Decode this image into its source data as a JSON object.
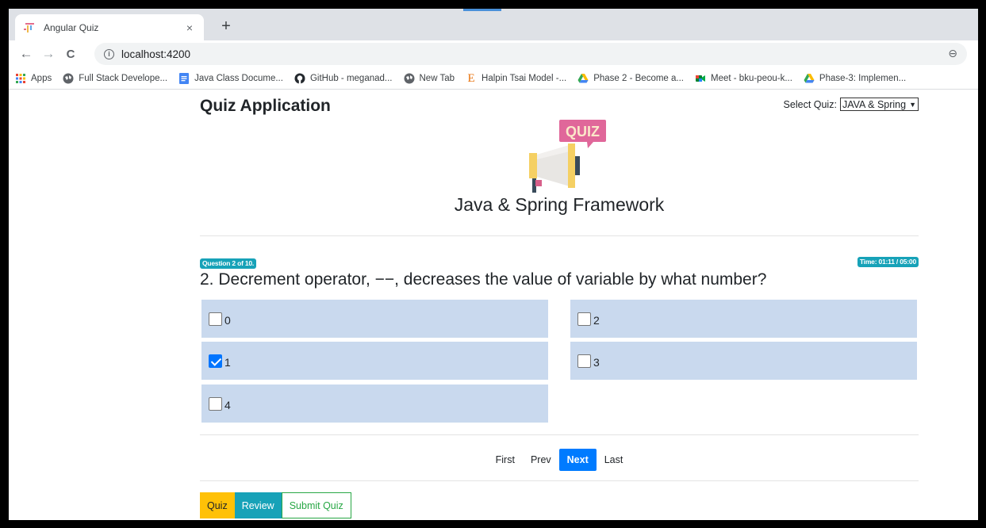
{
  "browser": {
    "tab_title": "Angular Quiz",
    "tab_close": "×",
    "new_tab": "+",
    "nav": {
      "back": "←",
      "forward": "→",
      "reload": "C"
    },
    "url": "localhost:4200",
    "zoom_icon": "⊖",
    "bookmarks": [
      {
        "label": "Apps",
        "icon": "apps-grid-icon"
      },
      {
        "label": "Full Stack Develope...",
        "icon": "globe-icon"
      },
      {
        "label": "Java Class Docume...",
        "icon": "google-docs-icon"
      },
      {
        "label": "GitHub - meganad...",
        "icon": "github-icon"
      },
      {
        "label": "New Tab",
        "icon": "globe-icon"
      },
      {
        "label": "Halpin Tsai Model -...",
        "icon": "e-letter-icon"
      },
      {
        "label": "Phase 2 - Become a...",
        "icon": "google-drive-icon"
      },
      {
        "label": "Meet - bku-peou-k...",
        "icon": "google-meet-icon"
      },
      {
        "label": "Phase-3: Implemen...",
        "icon": "google-drive-icon"
      }
    ]
  },
  "app": {
    "title": "Quiz Application",
    "select_label": "Select Quiz:",
    "selected_quiz": "JAVA & Spring",
    "logo_text": "QUIZ",
    "quiz_name": "Java & Spring Framework"
  },
  "question": {
    "badge": "Question 2 of 10.",
    "timer": "Time: 01:11 / 05:00",
    "text": "2. Decrement operator, −−, decreases the value of variable by what number?",
    "options": [
      {
        "label": "0",
        "checked": false
      },
      {
        "label": "2",
        "checked": false
      },
      {
        "label": "1",
        "checked": true
      },
      {
        "label": "3",
        "checked": false
      },
      {
        "label": "4",
        "checked": false
      }
    ]
  },
  "pager": {
    "first": "First",
    "prev": "Prev",
    "next": "Next",
    "last": "Last"
  },
  "modes": {
    "quiz": "Quiz",
    "review": "Review",
    "submit": "Submit Quiz"
  },
  "colors": {
    "option_bg": "#c9d9ee",
    "primary": "#007bff",
    "info": "#17a2b8",
    "warning": "#ffc107",
    "success": "#28a745"
  }
}
